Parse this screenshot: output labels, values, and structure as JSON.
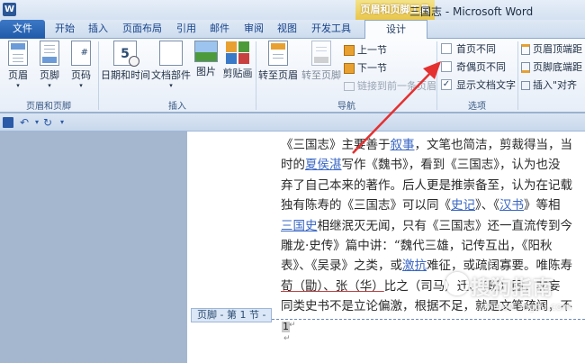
{
  "window": {
    "title": "三国志 - Microsoft Word",
    "app_logo": "W",
    "context_group": "页眉和页脚工具"
  },
  "tabs": [
    {
      "label": "文件"
    },
    {
      "label": "开始"
    },
    {
      "label": "插入"
    },
    {
      "label": "页面布局"
    },
    {
      "label": "引用"
    },
    {
      "label": "邮件"
    },
    {
      "label": "审阅"
    },
    {
      "label": "视图"
    },
    {
      "label": "开发工具"
    },
    {
      "label": "设计"
    }
  ],
  "ribbon": {
    "groups": {
      "header_footer": "页眉和页脚",
      "insert": "插入",
      "navigation": "导航",
      "options": "选项"
    },
    "buttons": {
      "header": "页眉",
      "footer": "页脚",
      "page_number": "页码",
      "date_time": "日期和时间",
      "doc_parts": "文档部件",
      "picture": "图片",
      "clip_art": "剪贴画",
      "goto_header": "转至页眉",
      "goto_footer": "转至页脚",
      "previous": "上一节",
      "next": "下一节",
      "link_previous": "链接到前一条页眉",
      "header_top": "页眉顶端距",
      "footer_bottom": "页脚底端距",
      "insert_align": "插入\"对齐"
    },
    "options": [
      {
        "label": "首页不同",
        "checked": false
      },
      {
        "label": "奇偶页不同",
        "checked": false
      },
      {
        "label": "显示文档文字",
        "checked": true
      }
    ]
  },
  "qat": {
    "save_icon": "save-icon",
    "undo_icon": "undo-icon",
    "redo_icon": "redo-icon"
  },
  "document": {
    "lines": [
      [
        {
          "t": "《三国志》主要善于"
        },
        {
          "t": "叙事",
          "s": "lk"
        },
        {
          "t": "，文笔也简洁，剪裁得当，当"
        }
      ],
      [
        {
          "t": "时的"
        },
        {
          "t": "夏侯湛",
          "s": "lk"
        },
        {
          "t": "写作《魏书》，看到《三国志》，认为也没"
        }
      ],
      [
        {
          "t": "弃了自己本来的著作。后人更是推崇备至，认为在记载"
        }
      ],
      [
        {
          "t": "独有陈寿的《三国志》可以同《"
        },
        {
          "t": "史记",
          "s": "lk"
        },
        {
          "t": "》、《"
        },
        {
          "t": "汉书",
          "s": "lk"
        },
        {
          "t": "》等相"
        }
      ],
      [
        {
          "t": "三国史",
          "s": "lk"
        },
        {
          "t": "相继泯灭无闻，只有《三国志》还一直流传到今"
        }
      ],
      [
        {
          "t": "雕龙·史传》篇中讲：“魏代三雄，记传互出，《阳秋"
        }
      ],
      [
        {
          "t": "表》、《吴录》之类，或"
        },
        {
          "t": "激抗",
          "s": "lk"
        },
        {
          "t": "难征，或疏阔寡要。唯陈寿"
        }
      ],
      [
        {
          "t": "荀（勖）、张（华）",
          "s": "ul"
        },
        {
          "t": "比之（司马）迁、（班）固，非妄"
        }
      ],
      [
        {
          "t": "同类史书不是立论偏激，根据不足，就是文笔疏阔，不"
        }
      ]
    ],
    "footer_tag": "页脚 - 第 1 节 -",
    "page_number": "1",
    "para_mark": "↵"
  },
  "watermark": {
    "main": "搜狗指南",
    "sub": "zhinan.sogou.com"
  },
  "colors": {
    "accent": "#1f5aa8",
    "context_yellow": "#e9c64a",
    "arrow_red": "#e53030"
  }
}
